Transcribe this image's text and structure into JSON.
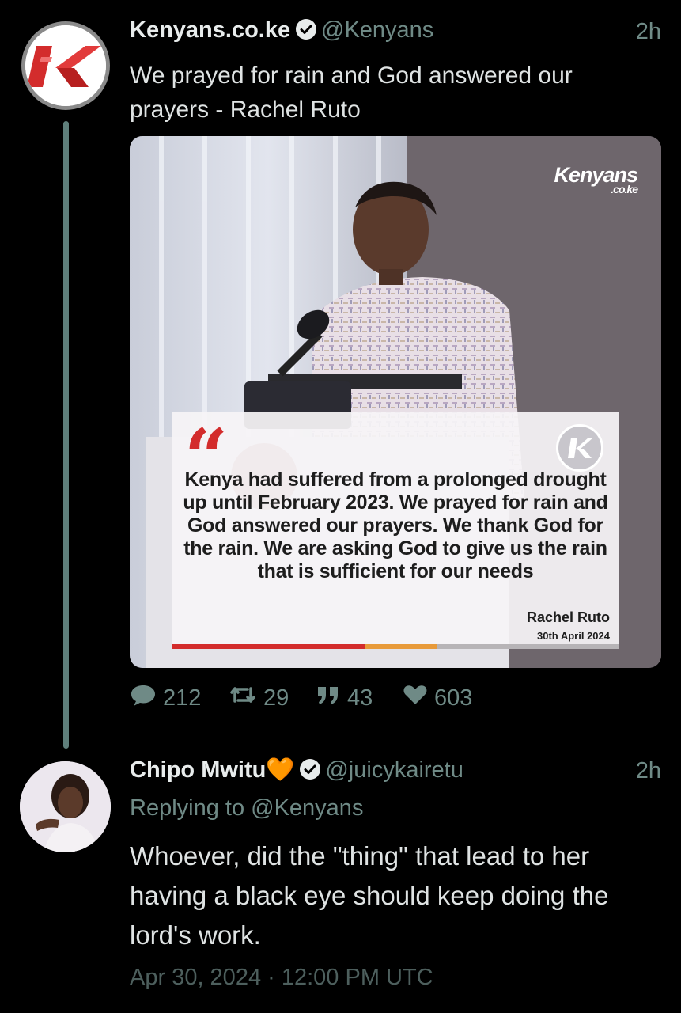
{
  "tweet": {
    "author_name": "Kenyans.co.ke",
    "handle": "@Kenyans",
    "time": "2h",
    "text": "We prayed for rain and God answered our prayers - Rachel Ruto",
    "media": {
      "watermark": "Kenyans",
      "watermark_sub": ".co.ke",
      "quote": "Kenya had suffered from a prolonged drought up until February 2023. We prayed for rain and God answered our prayers.  We thank God for the rain. We are asking God to give us the rain that is sufficient for our needs",
      "quote_author": "Rachel Ruto",
      "quote_date": "30th April 2024"
    },
    "stats": {
      "replies": "212",
      "retweets": "29",
      "quotes": "43",
      "likes": "603"
    }
  },
  "reply": {
    "author_name": "Chipo Mwitu🧡",
    "handle": "@juicykairetu",
    "time": "2h",
    "replying_to": "Replying to @Kenyans",
    "text": "Whoever, did the \"thing\" that lead to her having a black eye should keep doing the lord's work.",
    "timestamp": "Apr 30, 2024 · 12:00 PM UTC"
  },
  "colors": {
    "background": "#000000",
    "muted_teal": "#6f8a86",
    "verified": "#e8ecec",
    "brand_red": "#d32c2c"
  }
}
